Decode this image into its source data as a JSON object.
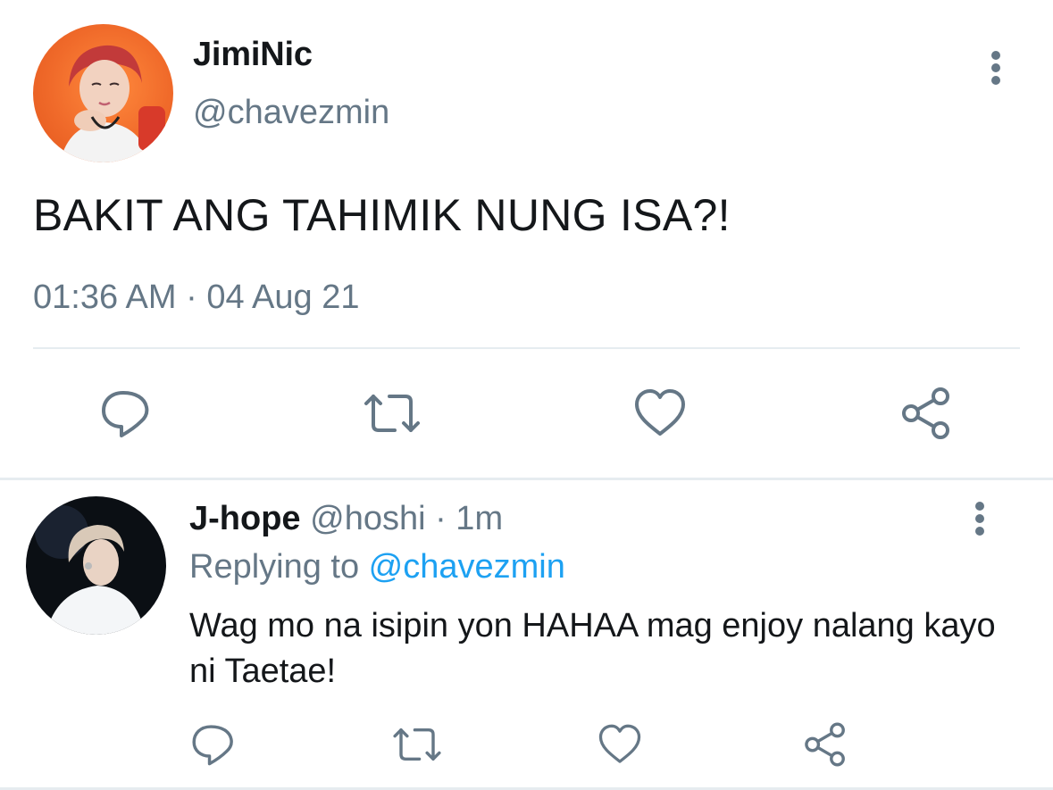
{
  "main_tweet": {
    "display_name": "JimiNic",
    "handle": "@chavezmin",
    "text": "BAKIT ANG TAHIMIK NUNG ISA?!",
    "timestamp": "01:36 AM · 04 Aug 21",
    "avatar_bg": "#f06a2a",
    "actions": [
      "reply-icon",
      "retweet-icon",
      "like-icon",
      "share-icon"
    ]
  },
  "reply_tweet": {
    "display_name": "J-hope",
    "handle_time": " @hoshi · 1m",
    "replying_prefix": "Replying to ",
    "replying_to": "@chavezmin",
    "text": "Wag mo na isipin yon HAHAA mag enjoy nalang kayo ni Taetae!",
    "avatar_bg": "#0b0f14",
    "actions": [
      "reply-icon",
      "retweet-icon",
      "like-icon",
      "share-icon"
    ]
  },
  "colors": {
    "text_primary": "#14171a",
    "text_secondary": "#657786",
    "link": "#1da1f2",
    "divider": "#e6ecf0"
  }
}
